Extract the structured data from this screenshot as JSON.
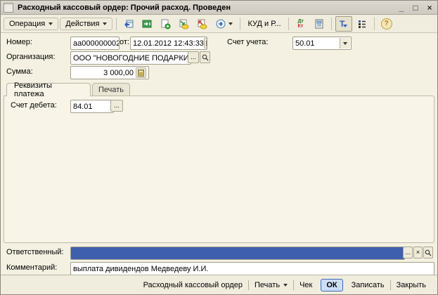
{
  "window": {
    "title": "Расходный кассовый ордер: Прочий расход. Проведен",
    "controls": {
      "minimize": "_",
      "maximize": "□",
      "close": "×"
    }
  },
  "toolbar": {
    "operation": {
      "label": "Операция"
    },
    "actions": {
      "label": "Действия"
    },
    "kud_button": {
      "label": "КУД и Р..."
    },
    "dtkt_icon": {
      "dt": "Дт",
      "kt": "Кт"
    },
    "t_icon_glyph": "Т",
    "help_glyph": "?"
  },
  "fields": {
    "number": {
      "label": "Номер:",
      "value": "аа000000002"
    },
    "date": {
      "label": "от:",
      "value": "12.01.2012 12:43:33"
    },
    "account": {
      "label": "Счет учета:",
      "value": "50.01"
    },
    "organization": {
      "label": "Организация:",
      "value": "ООО \"НОВОГОДНИЕ ПОДАРКИ\""
    },
    "amount": {
      "label": "Сумма:",
      "value": "3 000,00"
    },
    "debit_account": {
      "label": "Счет дебета:",
      "value": "84.01"
    },
    "responsible": {
      "label": "Ответственный:",
      "value": ""
    },
    "comment": {
      "label": "Комментарий:",
      "value": "выплата дивидендов Медведеву И.И."
    }
  },
  "tabs": [
    {
      "label": "Реквизиты платежа"
    },
    {
      "label": "Печать"
    }
  ],
  "buttons_misc": {
    "ellipsis": "...",
    "clear": "×"
  },
  "footer": {
    "buttons": {
      "print_form": "Расходный кассовый ордер",
      "print": "Печать",
      "check": "Чек",
      "ok": "ОК",
      "save": "Записать",
      "close": "Закрыть"
    }
  },
  "colors": {
    "form_bg": "#F4F1E2",
    "panel_bg": "#F8F5E8",
    "titlebar_bg": "#D5D1C8",
    "selection_blue": "#3E5EAE",
    "ok_button_bg": "#CBDFF6",
    "ok_button_border": "#3C6CB5"
  }
}
